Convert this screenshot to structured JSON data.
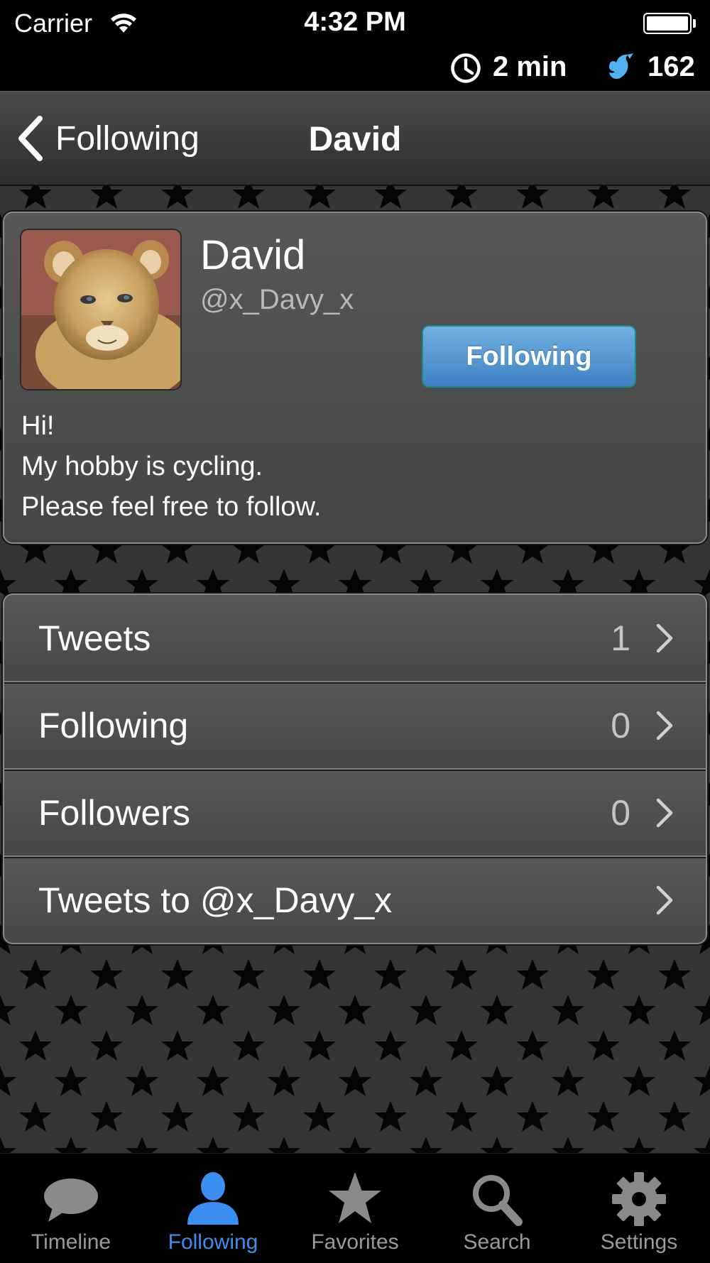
{
  "status_bar": {
    "carrier": "Carrier",
    "time": "4:32 PM",
    "time_ago": "2 min",
    "api_count": "162"
  },
  "nav": {
    "back_label": "Following",
    "title": "David"
  },
  "profile": {
    "name": "David",
    "handle": "@x_Davy_x",
    "follow_button_label": "Following",
    "bio_lines": [
      "Hi!",
      "My hobby is cycling.",
      "Please feel free to follow."
    ]
  },
  "list": [
    {
      "label": "Tweets",
      "count": "1"
    },
    {
      "label": "Following",
      "count": "0"
    },
    {
      "label": "Followers",
      "count": "0"
    },
    {
      "label": "Tweets to @x_Davy_x",
      "count": ""
    }
  ],
  "tabs": [
    {
      "label": "Timeline",
      "icon": "speech-bubble-icon",
      "active": false
    },
    {
      "label": "Following",
      "icon": "person-icon",
      "active": true
    },
    {
      "label": "Favorites",
      "icon": "star-icon",
      "active": false
    },
    {
      "label": "Search",
      "icon": "magnifier-icon",
      "active": false
    },
    {
      "label": "Settings",
      "icon": "gear-icon",
      "active": false
    }
  ],
  "colors": {
    "accent": "#3b8ff0",
    "follow_button": "#4f92d2",
    "bird_icon": "#4fb3f0"
  }
}
